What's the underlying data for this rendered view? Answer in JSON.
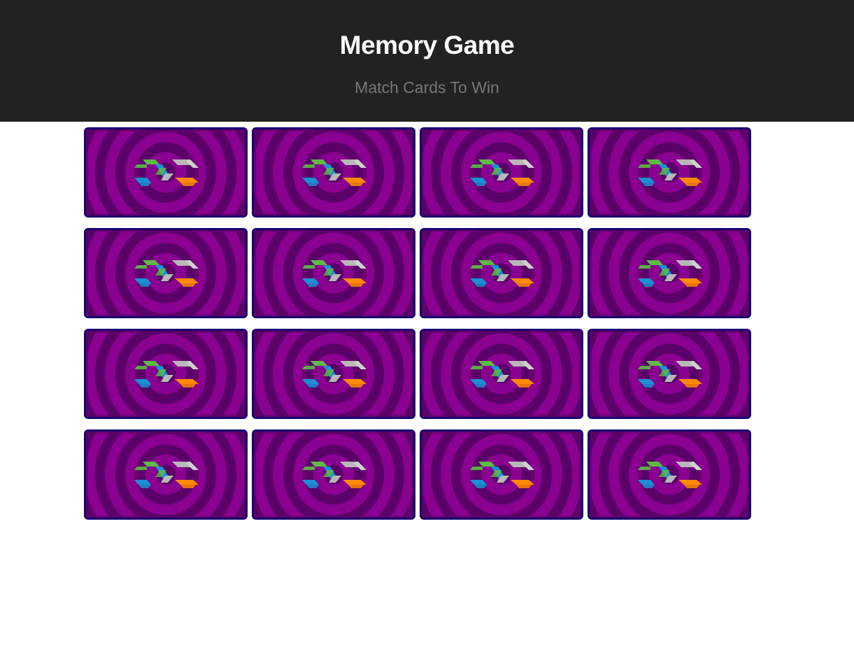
{
  "header": {
    "title": "Memory Game",
    "subtitle": "Match Cards To Win"
  },
  "board": {
    "rows": 4,
    "columns": 4,
    "card_face": "face-down",
    "card_back_icon": "infinity-logo-icon"
  },
  "colors": {
    "header_bg": "#222222",
    "card_border": "#1a0070",
    "card_ring_dark": "#5a0068",
    "card_ring_light": "#8a0090",
    "logo_green": "#5dbb46",
    "logo_blue": "#1a8fd4",
    "logo_gray": "#b8b8b8",
    "logo_orange": "#ff8a00"
  }
}
